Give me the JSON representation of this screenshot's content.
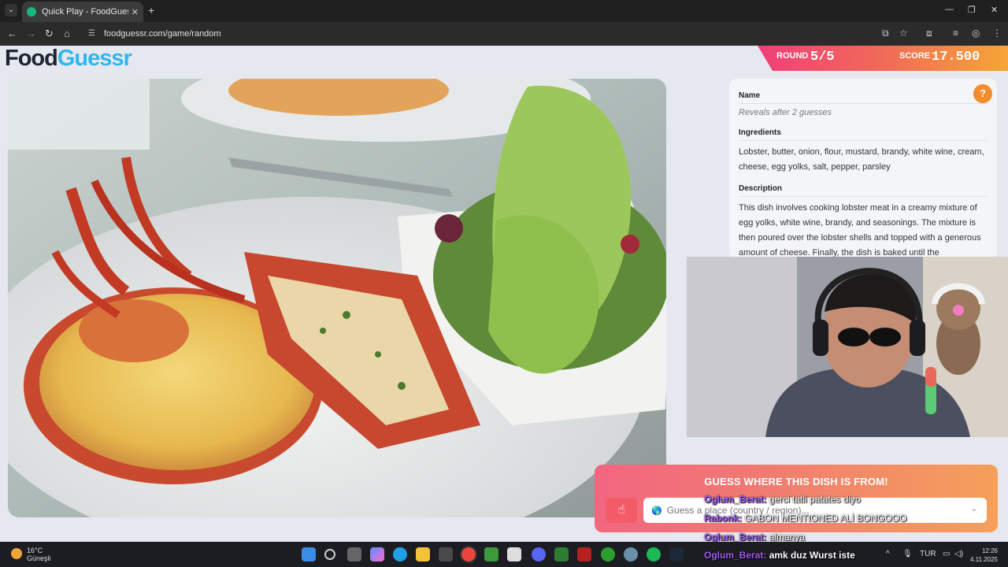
{
  "browser": {
    "tab_title": "Quick Play - FoodGuessr | Food",
    "tab_close": "✕",
    "new_tab": "+",
    "url": "foodguessr.com/game/random"
  },
  "logo": {
    "part1": "Food",
    "part2": "Guessr"
  },
  "round": {
    "label": "ROUND",
    "value": "5/5"
  },
  "score": {
    "label": "SCORE",
    "value": "17.500"
  },
  "info": {
    "name_label": "Name",
    "name_hint": "Reveals after 2 guesses",
    "ingredients_label": "Ingredients",
    "ingredients_text": "Lobster, butter, onion, flour, mustard, brandy, white wine, cream, cheese, egg yolks, salt, pepper, parsley",
    "description_label": "Description",
    "description_text": "This dish involves cooking lobster meat in a creamy mixture of egg yolks, white wine, brandy, and seasonings. The mixture is then poured over the lobster shells and topped with a generous amount of cheese. Finally, the dish is baked until the",
    "help": "?"
  },
  "guess": {
    "title": "GUESS WHERE THIS DISH IS FROM!",
    "placeholder": "Guess a place (country / region)..."
  },
  "chat": [
    {
      "user": "Oglum_Berat:",
      "msg": "gerci tatli patates diyo"
    },
    {
      "user": "Rabonk:",
      "msg": "GABON MENTIONED ALİ BONGOOO"
    },
    {
      "user": "Oglum_Berat:",
      "msg": "almanya"
    },
    {
      "user": "Oglum_Berat:",
      "msg": "amk duz Wurst iste"
    }
  ],
  "taskbar": {
    "weather_temp": "16°C",
    "weather_desc": "Güneşli",
    "weather_badge": "3",
    "lang": "TUR",
    "time": "12:26",
    "date": "4.11.2025"
  }
}
